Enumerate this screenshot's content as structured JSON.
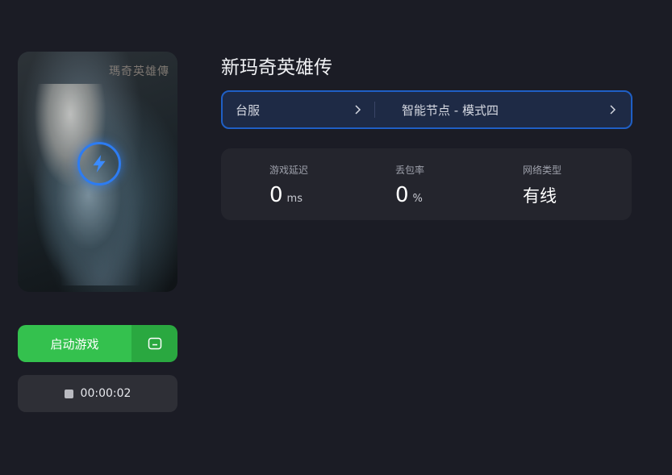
{
  "game": {
    "title": "新玛奇英雄传",
    "cover_logo_text": "瑪奇英雄傳"
  },
  "selector": {
    "region": "台服",
    "node": "智能节点 - 模式四"
  },
  "stats": {
    "latency": {
      "label": "游戏延迟",
      "value": "0",
      "unit": "ms"
    },
    "packet_loss": {
      "label": "丢包率",
      "value": "0",
      "unit": "%"
    },
    "network_type": {
      "label": "网络类型",
      "value": "有线"
    }
  },
  "actions": {
    "start_label": "启动游戏",
    "timer": "00:00:02"
  },
  "colors": {
    "accent_blue": "#1f5fc5",
    "start_green": "#34c14e",
    "background": "#1b1c25"
  }
}
